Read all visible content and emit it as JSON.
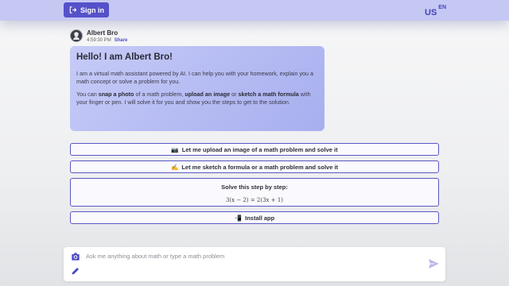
{
  "header": {
    "signin_label": "Sign in",
    "lang_country": "US",
    "lang_code": "EN"
  },
  "message": {
    "author": "Albert Bro",
    "time": "4:59:30 PM",
    "share_label": "Share",
    "title": "Hello! I am Albert Bro!",
    "para1": "I am a virtual math assistant powered by AI. I can help you with your homework, explain you a math concept or solve a problem for you.",
    "para2_a": "You can ",
    "para2_snap": "snap a photo",
    "para2_b": " of a math problem, ",
    "para2_upload": "upload an image",
    "para2_c": " or ",
    "para2_sketch": "sketch a math formula",
    "para2_d": " with your finger or pen. I will solve it for you and show you the steps to get to the solution."
  },
  "options": [
    {
      "emoji": "📷",
      "label": "Let me upload an image of a math problem and solve it"
    },
    {
      "emoji": "✍️",
      "label": "Let me sketch a formula or a math problem and solve it"
    },
    {
      "label": "Solve this step by step:",
      "formula": "3(x − 2) = 2(3x + 1)"
    },
    {
      "emoji": "📲",
      "label": "Install app"
    }
  ],
  "composer": {
    "placeholder": "Ask me anything about math or type a math problem"
  },
  "colors": {
    "accent": "#5551c9",
    "topbar": "#c5c8f3",
    "bubble": "#b3b9f2"
  },
  "icons": [
    "sign-in-icon",
    "avatar-icon",
    "camera-icon",
    "pencil-icon",
    "send-icon"
  ]
}
